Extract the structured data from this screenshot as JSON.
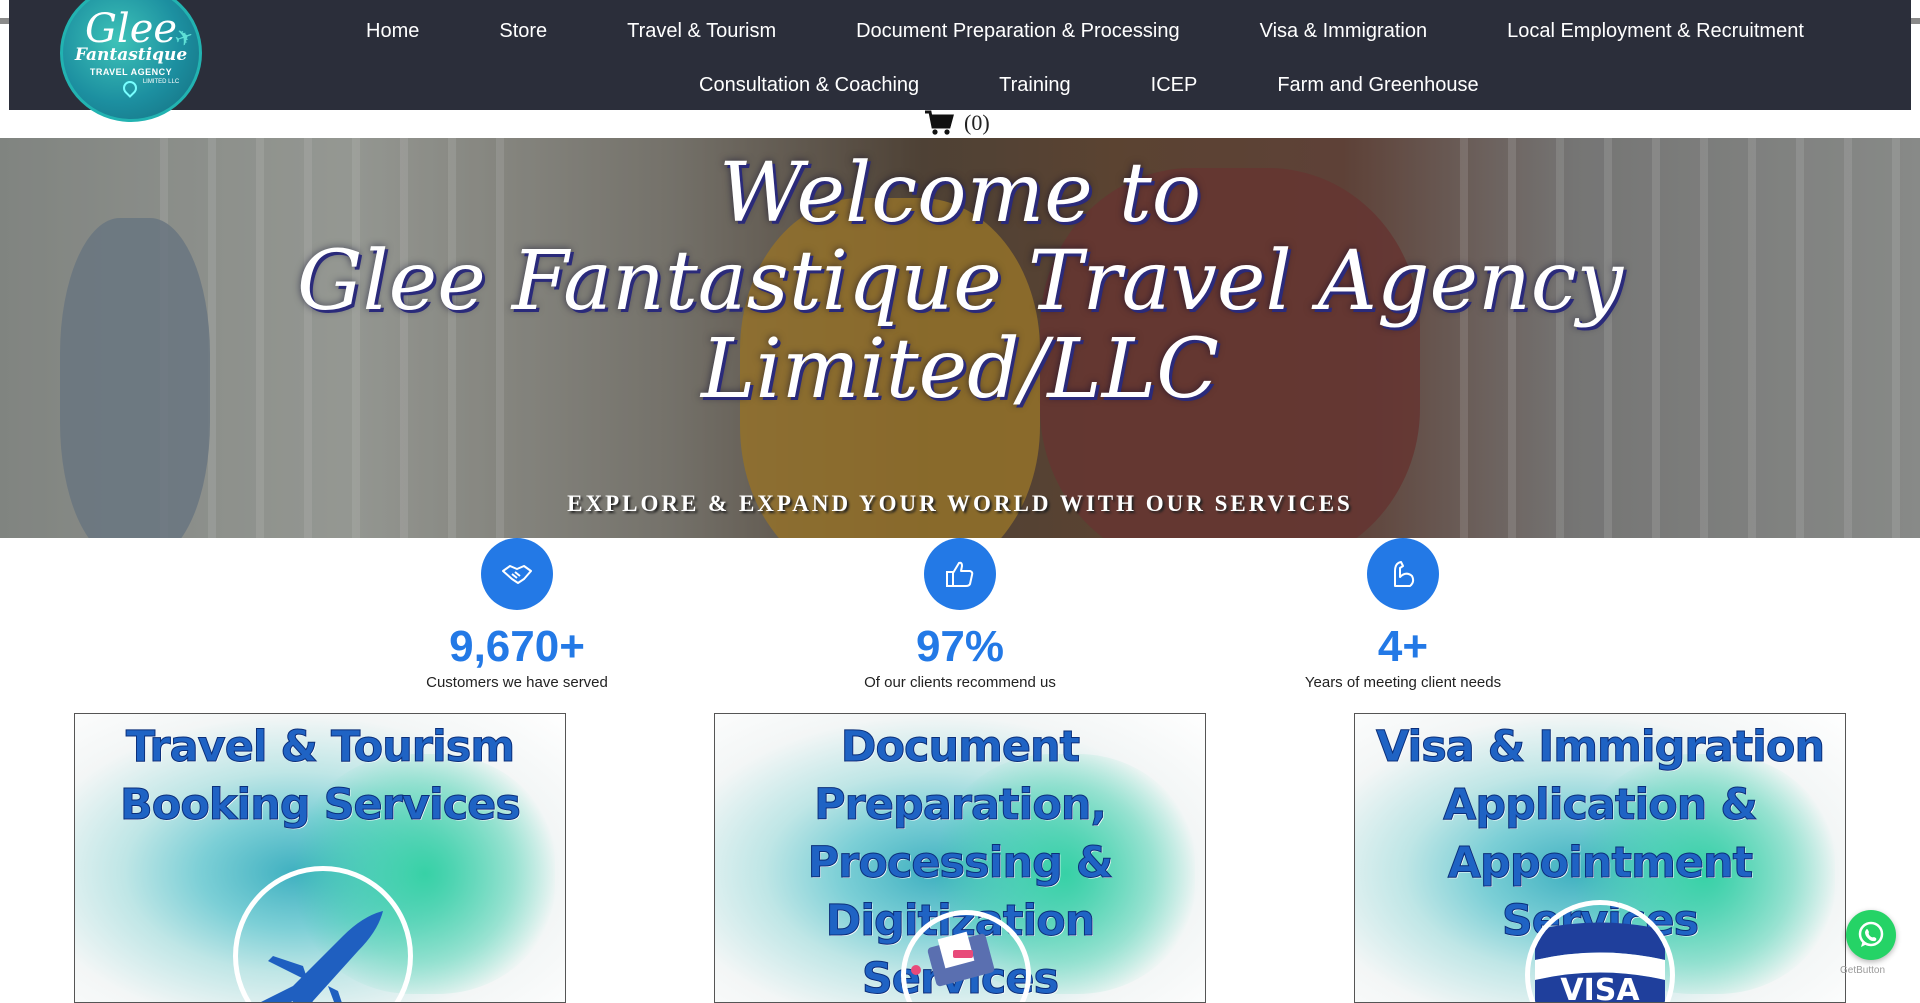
{
  "logo": {
    "line1": "Glee",
    "line2": "Fantastique",
    "line3": "TRAVEL AGENCY",
    "line4": "LIMITED LLC"
  },
  "nav": {
    "row1": [
      "Home",
      "Store",
      "Travel & Tourism",
      "Document Preparation & Processing",
      "Visa & Immigration",
      "Local Employment & Recruitment"
    ],
    "row2": [
      "Consultation & Coaching",
      "Training",
      "ICEP",
      "Farm and Greenhouse"
    ]
  },
  "cart": {
    "count_label": "(0)",
    "icon": "cart-icon"
  },
  "hero": {
    "line1": "Welcome to",
    "line2": "Glee Fantastique Travel Agency",
    "line3": "Limited/LLC",
    "subtitle": "EXPLORE & EXPAND YOUR WORLD WITH OUR SERVICES"
  },
  "stats": [
    {
      "icon": "handshake-icon",
      "value": "9,670+",
      "caption": "Customers we have served"
    },
    {
      "icon": "thumbs-up-icon",
      "value": "97%",
      "caption": "Of our clients recommend us"
    },
    {
      "icon": "flexed-arm-icon",
      "value": "4+",
      "caption": "Years of meeting client needs"
    }
  ],
  "cards": [
    {
      "title_l1": "Travel & Tourism",
      "title_l2": "Booking Services",
      "title_l3": "",
      "icon": "airplane-icon"
    },
    {
      "title_l1": "Document Preparation,",
      "title_l2": "Processing & Digitization",
      "title_l3": "Services",
      "icon": "document-scanner-icon"
    },
    {
      "title_l1": "Visa & Immigration",
      "title_l2": "Application & Appointment",
      "title_l3": "Services",
      "icon": "flag-visa-icon"
    }
  ],
  "whatsapp": {
    "icon": "whatsapp-icon",
    "credit": "GetButton"
  },
  "colors": {
    "nav_bg": "#2b2e3a",
    "accent": "#2379e6",
    "card_title": "#1f63c4",
    "whatsapp": "#25d366"
  }
}
